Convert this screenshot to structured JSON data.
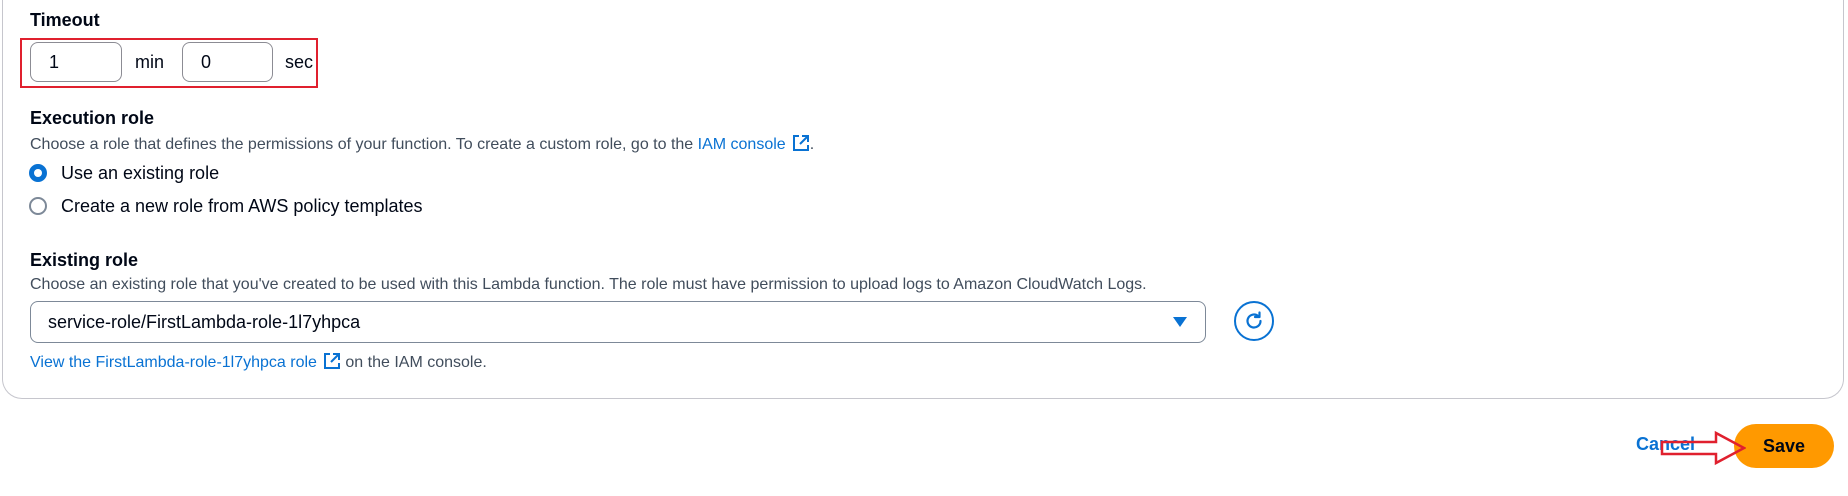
{
  "timeout": {
    "label": "Timeout",
    "minutes_value": "1",
    "minutes_unit": "min",
    "seconds_value": "0",
    "seconds_unit": "sec"
  },
  "execution_role": {
    "label": "Execution role",
    "description_prefix": "Choose a role that defines the permissions of your function. To create a custom role, go to the ",
    "iam_console_link": "IAM console",
    "description_suffix": ".",
    "options": [
      {
        "label": "Use an existing role",
        "checked": true
      },
      {
        "label": "Create a new role from AWS policy templates",
        "checked": false
      }
    ]
  },
  "existing_role": {
    "label": "Existing role",
    "description": "Choose an existing role that you've created to be used with this Lambda function. The role must have permission to upload logs to Amazon CloudWatch Logs.",
    "selected_value": "service-role/FirstLambda-role-1l7yhpca",
    "view_link": "View the FirstLambda-role-1l7yhpca role",
    "view_suffix": "on the IAM console."
  },
  "footer": {
    "cancel_label": "Cancel",
    "save_label": "Save"
  },
  "colors": {
    "accent": "#0972d3",
    "primary_button": "#ff9900",
    "annotation": "#e0202e"
  }
}
